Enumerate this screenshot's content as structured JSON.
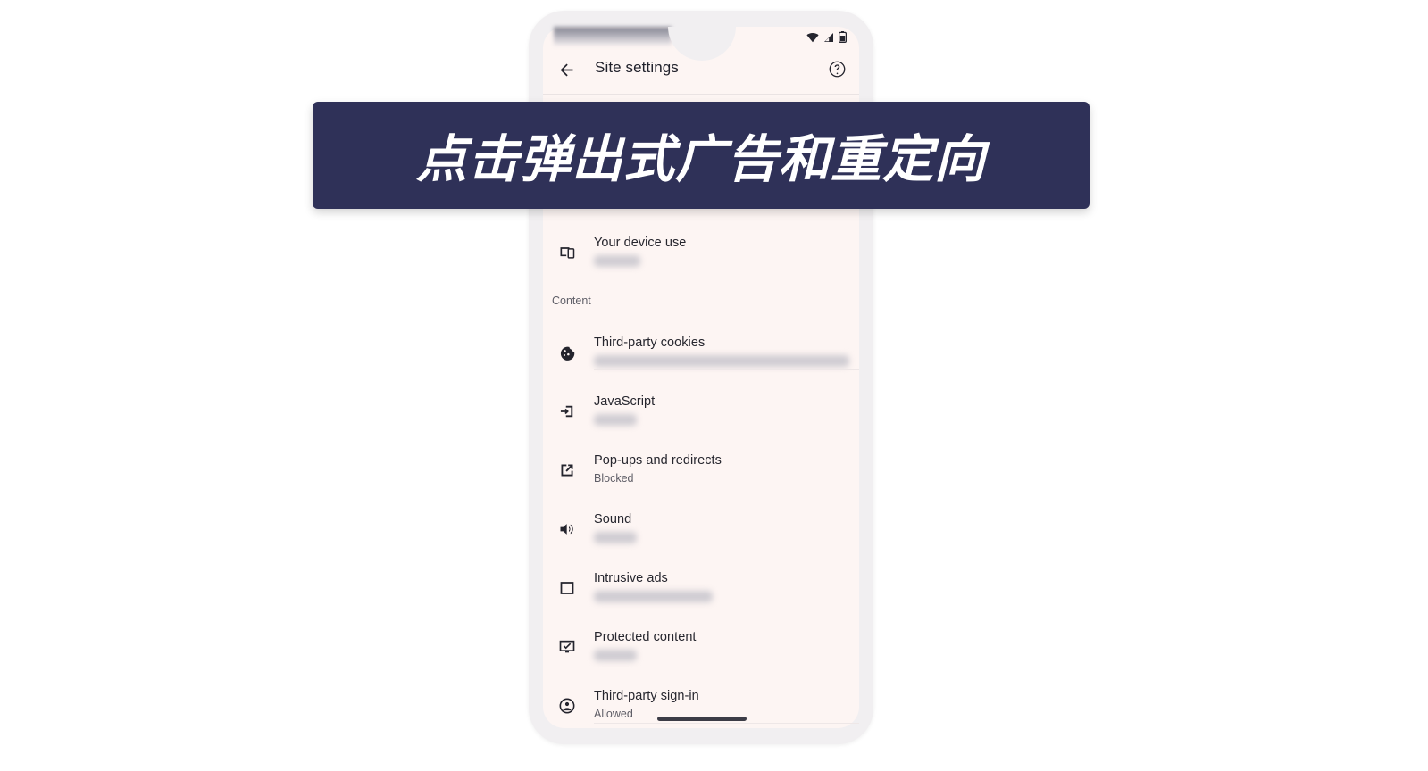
{
  "banner": {
    "text": "点击弹出式广告和重定向",
    "background_color": "#2F3158",
    "text_color": "#FFFFFF"
  },
  "phone": {
    "frame_color": "#F1EFF1",
    "screen_color": "#FDF5F3",
    "status_bar": {
      "wifi_icon": "wifi-icon",
      "signal_icon": "cell-signal-icon",
      "battery_icon": "battery-icon"
    },
    "app_bar": {
      "back_icon": "back-arrow-icon",
      "title": "Site settings",
      "help_icon": "help-circle-icon"
    },
    "home_indicator": true
  },
  "settings_list": {
    "items": [
      {
        "icon": "devices-icon",
        "title": "Your device use",
        "subtitle": "",
        "subtitle_blurred": true,
        "subtitle_width": 52
      }
    ],
    "section": {
      "label": "Content",
      "items": [
        {
          "icon": "cookie-icon",
          "title": "Third-party cookies",
          "subtitle": "",
          "subtitle_blurred": true,
          "subtitle_width": 286
        },
        {
          "icon": "javascript-icon",
          "title": "JavaScript",
          "subtitle": "",
          "subtitle_blurred": true,
          "subtitle_width": 48
        },
        {
          "icon": "open-in-new-icon",
          "title": "Pop-ups and redirects",
          "subtitle": "Blocked",
          "subtitle_blurred": false,
          "subtitle_width": 0
        },
        {
          "icon": "volume-up-icon",
          "title": "Sound",
          "subtitle": "",
          "subtitle_blurred": true,
          "subtitle_width": 48
        },
        {
          "icon": "ad-block-icon",
          "title": "Intrusive ads",
          "subtitle": "",
          "subtitle_blurred": true,
          "subtitle_width": 133
        },
        {
          "icon": "protected-content-icon",
          "title": "Protected content",
          "subtitle": "",
          "subtitle_blurred": true,
          "subtitle_width": 48
        },
        {
          "icon": "account-circle-icon",
          "title": "Third-party sign-in",
          "subtitle": "Allowed",
          "subtitle_blurred": false,
          "subtitle_width": 0
        }
      ]
    }
  }
}
